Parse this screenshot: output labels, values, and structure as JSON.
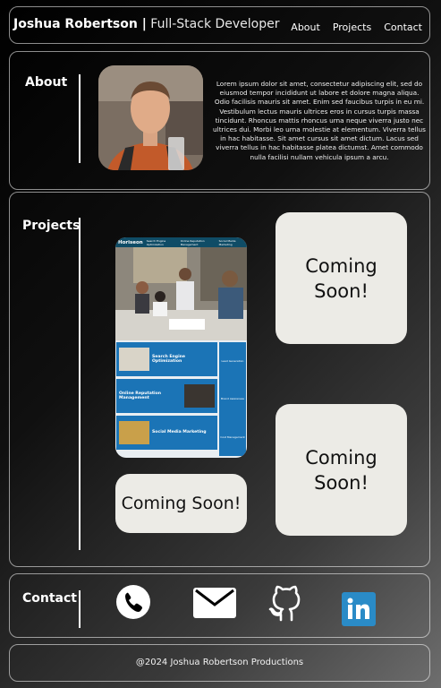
{
  "header": {
    "name": "Joshua Robertson |",
    "role": "Full-Stack Developer",
    "nav": [
      "About",
      "Projects",
      "Contact"
    ]
  },
  "about": {
    "title": "About",
    "text": "Lorem ipsum dolor sit amet, consectetur adipiscing elit, sed do eiusmod tempor incididunt ut labore et dolore magna aliqua. Odio facilisis mauris sit amet. Enim sed faucibus turpis in eu mi. Vestibulum lectus mauris ultrices eros in cursus turpis massa tincidunt. Rhoncus mattis rhoncus urna neque viverra justo nec ultrices dui. Morbi leo urna molestie at elementum. Viverra tellus in hac habitasse. Sit amet cursus sit amet dictum. Lacus sed viverra tellus in hac habitasse platea dictumst. Amet commodo nulla facilisi nullam vehicula ipsum a arcu."
  },
  "projects": {
    "title": "Projects",
    "project_site": {
      "logo": "Horiseon",
      "nav": [
        "Search Engine Optimization",
        "Online Reputation Management",
        "Social Media Marketing"
      ],
      "services": [
        "Search Engine Optimization",
        "Online Reputation Management",
        "Social Media Marketing"
      ],
      "side": [
        "Lead Generation",
        "Brand Awareness",
        "Cost Management"
      ]
    },
    "coming_soon_1": "Coming\nSoon!",
    "coming_soon_2": "Coming\nSoon!",
    "coming_soon_3": "Coming Soon!"
  },
  "contact": {
    "title": "Contact",
    "icons": [
      "phone-icon",
      "mail-icon",
      "github-icon",
      "linkedin-icon"
    ]
  },
  "footer": {
    "copyright": "@2024 Joshua Robertson Productions"
  }
}
